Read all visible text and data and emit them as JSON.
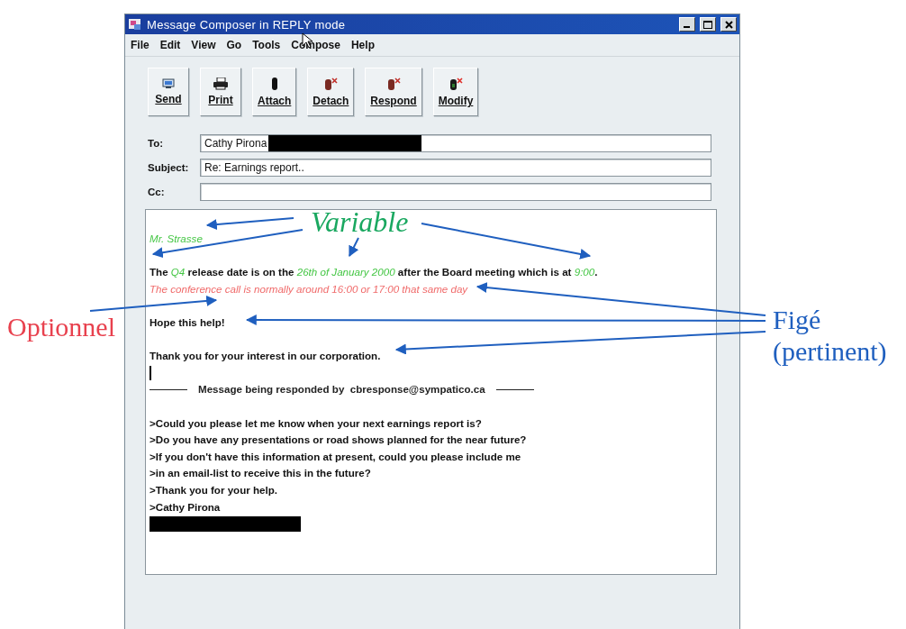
{
  "window": {
    "title": "Message Composer in REPLY mode"
  },
  "menu": [
    "File",
    "Edit",
    "View",
    "Go",
    "Tools",
    "Compose",
    "Help"
  ],
  "toolbar": [
    {
      "label": "Send",
      "kind": "send"
    },
    {
      "label": "Print",
      "kind": "print"
    },
    {
      "label": "Attach",
      "kind": "attach"
    },
    {
      "label": "Detach",
      "kind": "detach"
    },
    {
      "label": "Respond",
      "kind": "respond"
    },
    {
      "label": "Modify",
      "kind": "modify"
    }
  ],
  "fields": [
    {
      "label": "To:",
      "value": "Cathy Pirona",
      "redacted": true
    },
    {
      "label": "Subject:",
      "value": "Re: Earnings report..",
      "redacted": false
    },
    {
      "label": "Cc:",
      "redacted": false
    }
  ],
  "body": {
    "lines": [
      {
        "kind": "text",
        "segments": [
          {
            "text": "Mr. Strasse",
            "kind": "variable"
          }
        ]
      },
      {
        "kind": "blank"
      },
      {
        "kind": "text",
        "segments": [
          {
            "text": "The ",
            "kind": "fixed"
          },
          {
            "text": "Q4",
            "kind": "variable"
          },
          {
            "text": " release date is on the ",
            "kind": "fixed"
          },
          {
            "text": "26th of January 2000",
            "kind": "variable"
          },
          {
            "text": " after the Board meeting which is at ",
            "kind": "fixed"
          },
          {
            "text": "9:00",
            "kind": "variable"
          },
          {
            "text": ".",
            "kind": "fixed"
          }
        ]
      },
      {
        "kind": "text",
        "segments": [
          {
            "text": "The conference call is normally around 16:00 or 17:00 that same day",
            "kind": "optional"
          }
        ]
      },
      {
        "kind": "blank"
      },
      {
        "kind": "text",
        "segments": [
          {
            "text": "Hope this help!",
            "kind": "fixed"
          }
        ]
      },
      {
        "kind": "blank"
      },
      {
        "kind": "text",
        "segments": [
          {
            "text": "Thank you for your interest in our corporation.",
            "kind": "fixed"
          }
        ]
      },
      {
        "kind": "cursor"
      },
      {
        "kind": "separator",
        "text": "Message being responded by  cbresponse@sympatico.ca"
      },
      {
        "kind": "blank"
      },
      {
        "kind": "text",
        "segments": [
          {
            "text": ">Could you please let me know when your next earnings report is?",
            "kind": "fixed"
          }
        ]
      },
      {
        "kind": "text",
        "segments": [
          {
            "text": ">Do you have any presentations or road shows planned for the near future?",
            "kind": "fixed"
          }
        ]
      },
      {
        "kind": "text",
        "segments": [
          {
            "text": ">If you don't have this information at present, could you please include me",
            "kind": "fixed"
          }
        ]
      },
      {
        "kind": "text",
        "segments": [
          {
            "text": ">in an email-list to receive this in the future?",
            "kind": "fixed"
          }
        ]
      },
      {
        "kind": "text",
        "segments": [
          {
            "text": ">Thank you for your help.",
            "kind": "fixed"
          }
        ]
      },
      {
        "kind": "text",
        "segments": [
          {
            "text": ">Cathy Pirona",
            "kind": "fixed"
          }
        ]
      },
      {
        "kind": "redacted"
      }
    ]
  },
  "annotations": [
    {
      "lines": [
        "Variable"
      ],
      "color": "#1aa860"
    },
    {
      "lines": [
        "Optionnel"
      ],
      "color": "#e8414e"
    },
    {
      "lines": [
        "Figé",
        "(pertinent)"
      ],
      "color": "#1f5fbf"
    }
  ]
}
